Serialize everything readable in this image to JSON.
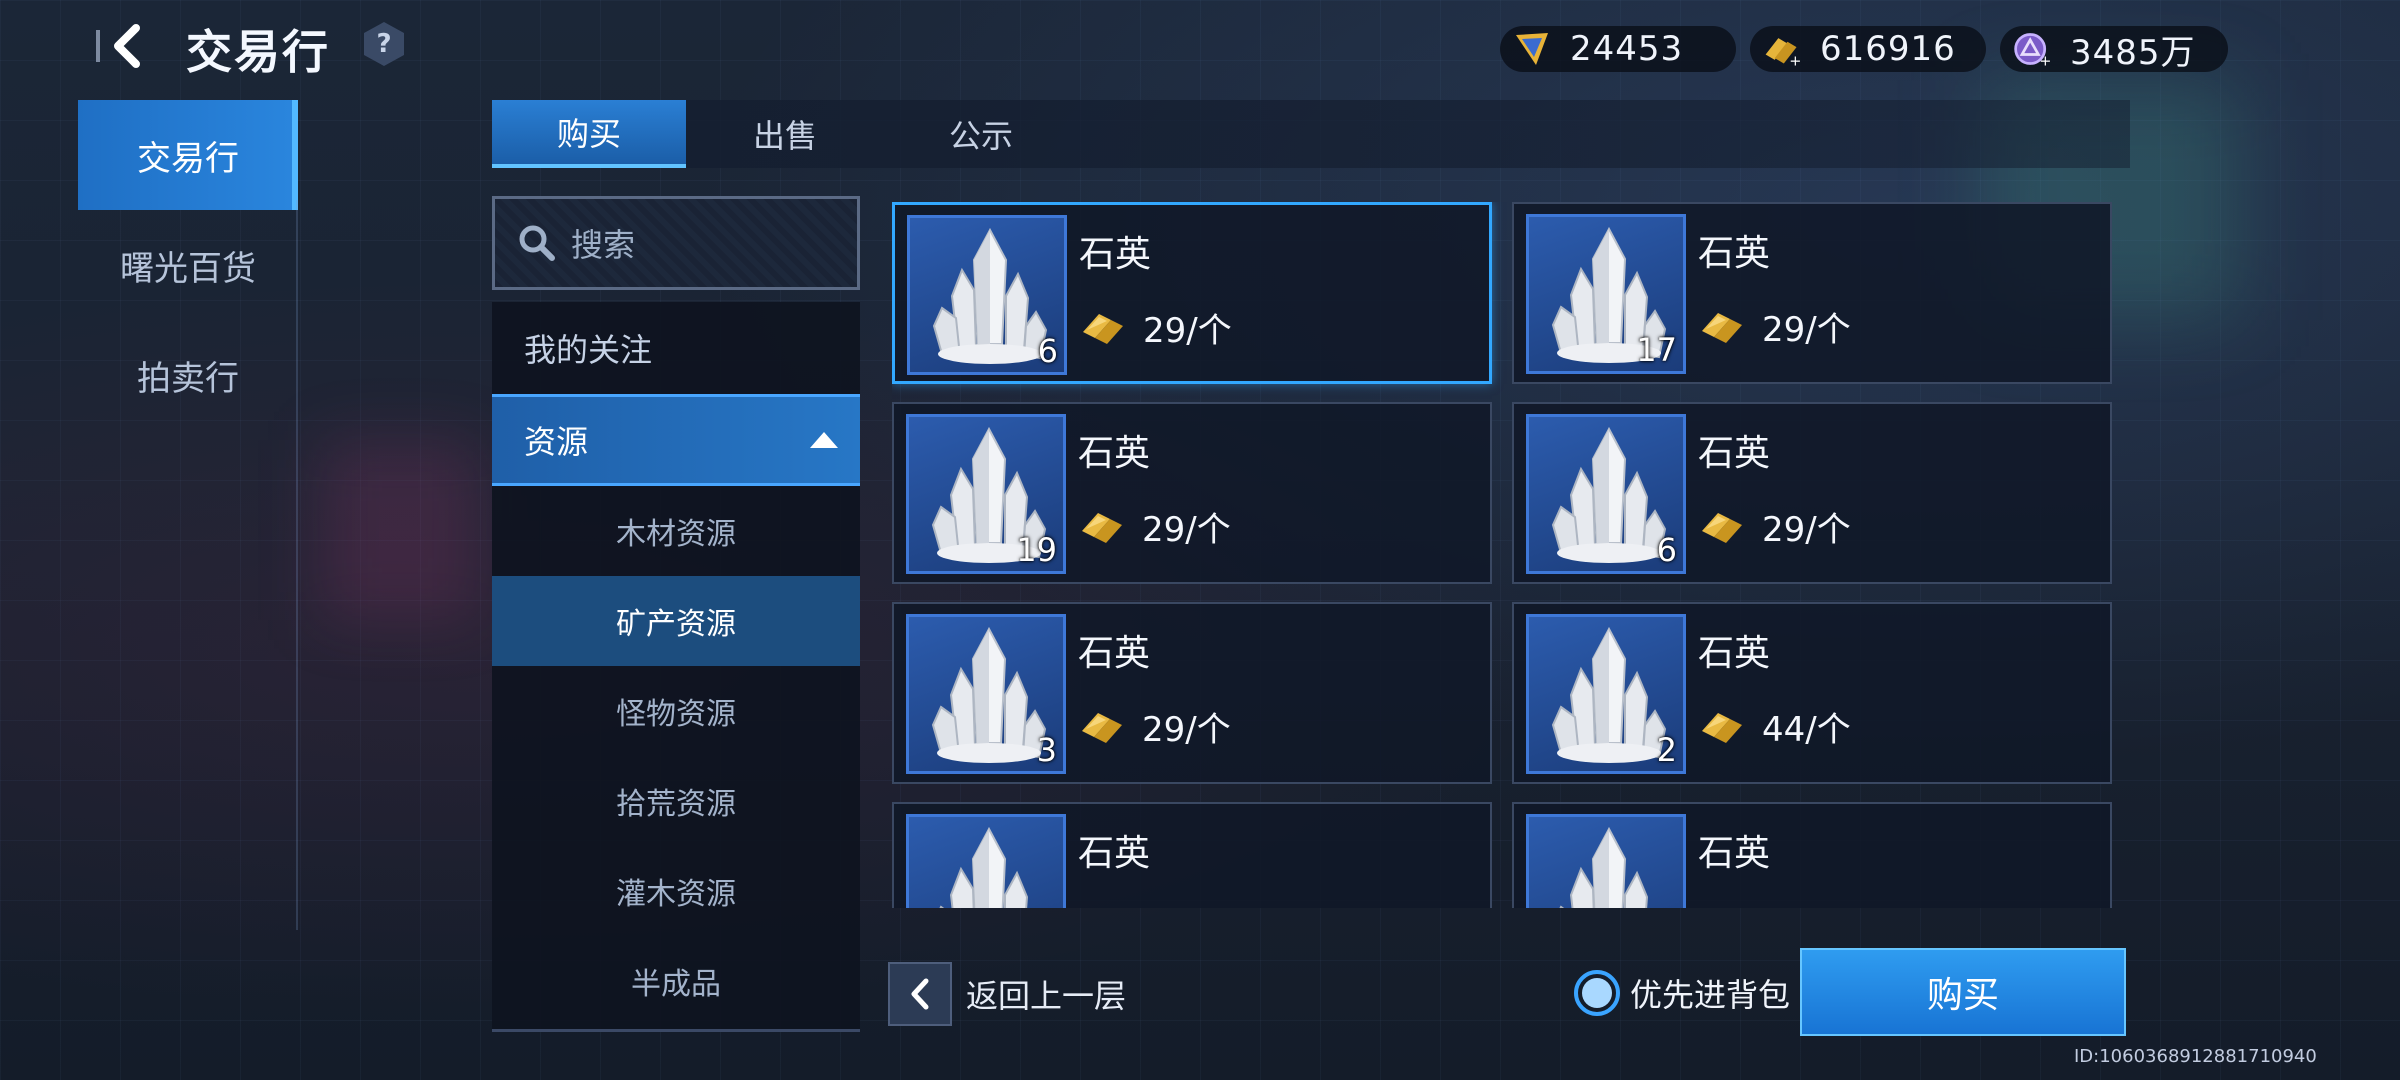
{
  "header": {
    "title": "交易行",
    "help": "?"
  },
  "currencies": [
    {
      "icon": "energy-crystal-icon",
      "value": "24453"
    },
    {
      "icon": "gold-bars-plus-icon",
      "value": "616916"
    },
    {
      "icon": "purple-coin-plus-icon",
      "value": "3485万"
    }
  ],
  "leftnav": {
    "items": [
      {
        "label": "交易行",
        "active": true
      },
      {
        "label": "曙光百货",
        "active": false
      },
      {
        "label": "拍卖行",
        "active": false
      }
    ]
  },
  "tabs": [
    {
      "label": "购买",
      "active": true
    },
    {
      "label": "出售",
      "active": false
    },
    {
      "label": "公示",
      "active": false
    }
  ],
  "search": {
    "label": "搜索"
  },
  "categories": {
    "favorites": "我的关注",
    "group": "资源",
    "subs": [
      {
        "label": "木材资源",
        "active": false
      },
      {
        "label": "矿产资源",
        "active": true
      },
      {
        "label": "怪物资源",
        "active": false
      },
      {
        "label": "拾荒资源",
        "active": false
      },
      {
        "label": "灌木资源",
        "active": false
      },
      {
        "label": "半成品",
        "active": false
      }
    ]
  },
  "items": [
    {
      "name": "石英",
      "qty": "6",
      "price": "29/个",
      "selected": true
    },
    {
      "name": "石英",
      "qty": "17",
      "price": "29/个",
      "selected": false
    },
    {
      "name": "石英",
      "qty": "19",
      "price": "29/个",
      "selected": false
    },
    {
      "name": "石英",
      "qty": "6",
      "price": "29/个",
      "selected": false
    },
    {
      "name": "石英",
      "qty": "3",
      "price": "29/个",
      "selected": false
    },
    {
      "name": "石英",
      "qty": "2",
      "price": "44/个",
      "selected": false
    },
    {
      "name": "石英",
      "qty": "",
      "price": "",
      "selected": false
    },
    {
      "name": "石英",
      "qty": "",
      "price": "",
      "selected": false
    }
  ],
  "bottom": {
    "back_label": "返回上一层",
    "priority_label": "优先进背包",
    "buy_label": "购买",
    "uid": "ID:1060368912881710940"
  },
  "colors": {
    "accent": "#2a86de",
    "selected_border": "#32a8ff"
  }
}
